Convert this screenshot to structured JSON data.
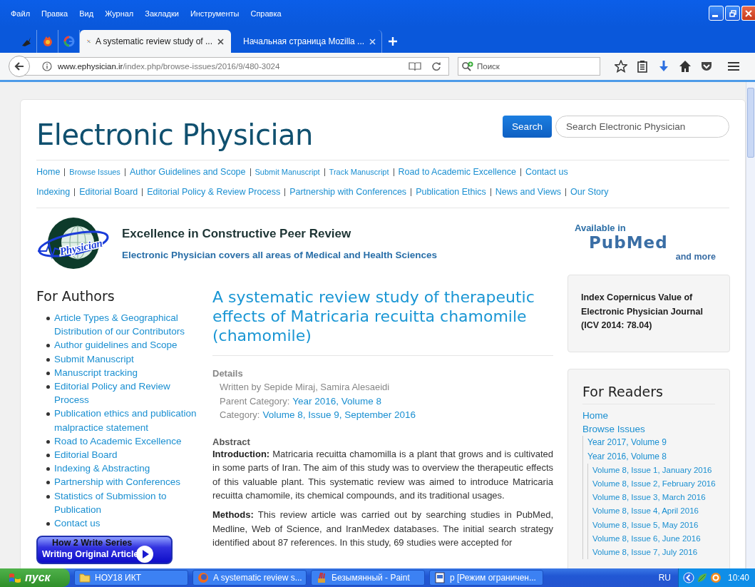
{
  "menu_bar": [
    "Файл",
    "Правка",
    "Вид",
    "Журнал",
    "Закладки",
    "Инструменты",
    "Справка"
  ],
  "tabs": [
    {
      "kind": "pinned",
      "selected": false
    },
    {
      "kind": "pinned",
      "selected": false
    },
    {
      "kind": "pinned",
      "selected": false
    },
    {
      "kind": "page",
      "title": "A systematic review study of ...",
      "selected": true
    },
    {
      "kind": "page",
      "title": "Начальная страница Mozilla ...",
      "selected": false
    }
  ],
  "address_bar": {
    "host": "www.ephysician.ir",
    "path": "/index.php/browse-issues/2016/9/480-3024"
  },
  "browser_search": {
    "placeholder": "Поиск"
  },
  "site": {
    "title": "Electronic Physician",
    "search_button": "Search",
    "search_placeholder": "Search Electronic Physician",
    "nav_rows": [
      [
        "Home",
        "Browse Issues",
        "Author Guidelines and Scope",
        "Submit Manuscript",
        "Track Manuscript",
        "Road to Academic Excellence",
        "Contact us"
      ],
      [
        "Indexing",
        "Editorial Board",
        "Editorial Policy & Review Process",
        "Partnership with Conferences",
        "Publication Ethics",
        "News and Views",
        "Our Story"
      ]
    ]
  },
  "banner": {
    "logo_text": "Physician",
    "heading": "Excellence in Constructive Peer Review",
    "subheading": "Electronic Physician covers all areas of Medical and Health Sciences"
  },
  "pubmed": {
    "available": "Available in",
    "logo": "PubMed",
    "more": "and more"
  },
  "for_authors": {
    "title": "For Authors",
    "items": [
      "Article Types & Geographical Distribution of our Contributors",
      "Author guidelines and Scope",
      "Submit Manuscript",
      "Manuscript tracking",
      "Editorial Policy and Review Process",
      "Publication ethics and publication malpractice statement",
      "Road to Academic Excellence",
      "Editorial Board",
      "Indexing & Abstracting",
      "Partnership with Conferences",
      "Statistics of Submission to Publication",
      "Contact us"
    ]
  },
  "promo": {
    "line_1": "How 2 Write Series",
    "line_2": "Writing Original Article"
  },
  "article": {
    "title": "A systematic review study of therapeutic effects of Matricaria recuitta chamomile (chamomile)",
    "details_label": "Details",
    "author": "Written by Sepide Miraj, Samira Alesaeidi",
    "parent_label": "Parent Category:",
    "parent_link": "Year 2016, Volume 8",
    "category_label": "Category:",
    "category_link": "Volume 8, Issue 9, September 2016",
    "abstract_label": "Abstract",
    "paragraphs": [
      "**Introduction:** Matricaria recuitta chamomilla is a plant that grows and is cultivated in some parts of Iran. The aim of this study was to overview the therapeutic effects of this valuable plant. This systematic review was aimed to introduce Matricaria recuitta chamomile, its chemical compounds, and its traditional usages.",
      "**Methods:** This review article was carried out by searching studies in PubMed, Medline, Web of Science, and IranMedex databases. The initial search strategy identified about 87 references. In this study, 69 studies were accepted for"
    ]
  },
  "index_box": {
    "text": "Index Copernicus Value of Electronic Physician Journal (ICV 2014: 78.04)"
  },
  "for_readers": {
    "title": "For Readers",
    "items": [
      {
        "label": "Home"
      },
      {
        "label": "Browse Issues",
        "children": [
          {
            "label": "Year 2017, Volume 9"
          },
          {
            "label": "Year 2016, Volume 8",
            "children": [
              {
                "label": "Volume 8, Issue 1, January 2016"
              },
              {
                "label": "Volume 8, Issue 2, February 2016"
              },
              {
                "label": "Volume 8, Issue 3, March 2016"
              },
              {
                "label": "Volume 8, Issue 4, April 2016"
              },
              {
                "label": "Volume 8, Issue 5, May 2016"
              },
              {
                "label": "Volume 8, Issue 6, June 2016"
              },
              {
                "label": "Volume 8, Issue 7, July 2016"
              }
            ]
          }
        ]
      }
    ]
  },
  "taskbar": {
    "start": "пуск",
    "items": [
      {
        "kind": "folder",
        "label": "НОУ18 ИКТ"
      },
      {
        "kind": "browser",
        "label": "A systematic review s..."
      },
      {
        "kind": "paint",
        "label": "Безымянный - Paint"
      },
      {
        "kind": "document",
        "label": "р [Режим ограничен..."
      }
    ],
    "language": "RU",
    "clock": "10:40"
  }
}
